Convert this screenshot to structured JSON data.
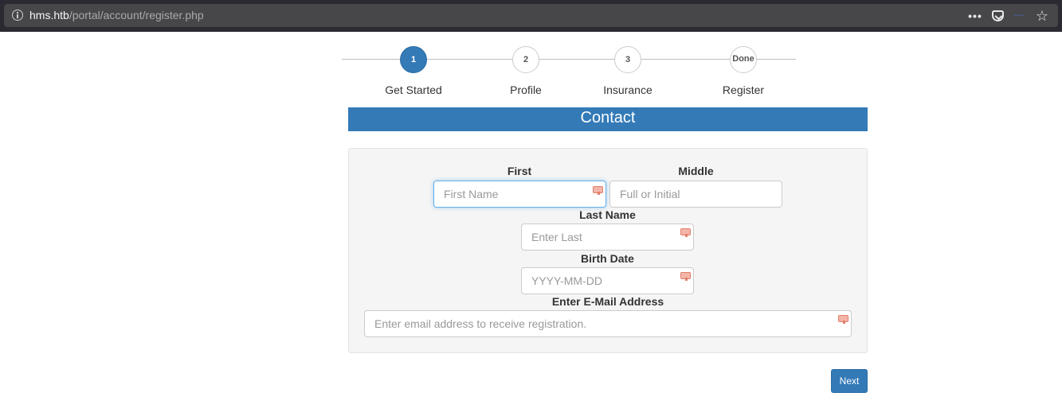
{
  "browser": {
    "url_host": "hms.htb",
    "url_path": "/portal/account/register.php"
  },
  "stepper": {
    "steps": [
      {
        "number": "1",
        "label": "Get Started",
        "state": "active"
      },
      {
        "number": "2",
        "label": "Profile",
        "state": "pending"
      },
      {
        "number": "3",
        "label": "Insurance",
        "state": "pending"
      },
      {
        "number": "Done",
        "label": "Register",
        "state": "pending"
      }
    ]
  },
  "section_title": "Contact",
  "form": {
    "first": {
      "label": "First",
      "placeholder": "First Name",
      "value": ""
    },
    "middle": {
      "label": "Middle",
      "placeholder": "Full or Initial",
      "value": ""
    },
    "last": {
      "label": "Last Name",
      "placeholder": "Enter Last",
      "value": ""
    },
    "birth": {
      "label": "Birth Date",
      "placeholder": "YYYY-MM-DD",
      "value": ""
    },
    "email": {
      "label": "Enter E-Mail Address",
      "placeholder": "Enter email address to receive registration.",
      "value": ""
    }
  },
  "next_label": "Next",
  "colors": {
    "accent": "#337ab7",
    "panel_bg": "#f5f5f5"
  }
}
